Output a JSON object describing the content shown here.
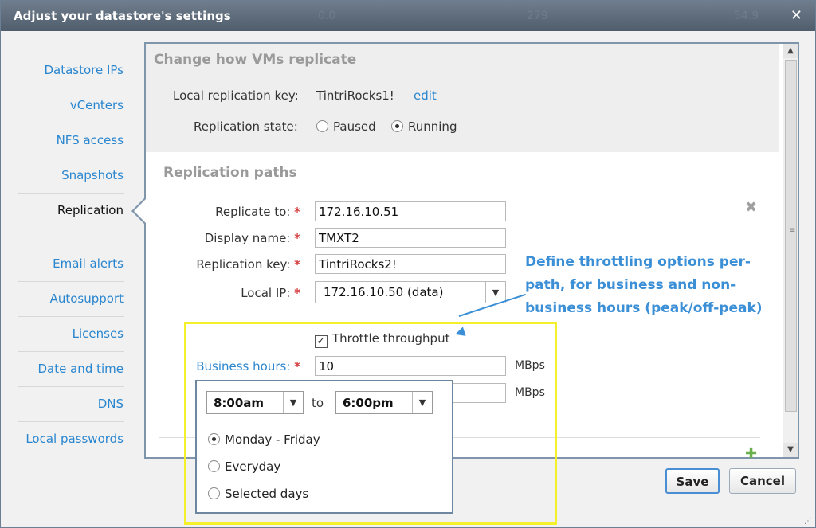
{
  "dialog": {
    "title": "Adjust your datastore's settings",
    "close_label": "✕",
    "ghost_values": [
      "0.0",
      "279",
      "54.9"
    ]
  },
  "nav": {
    "items": [
      {
        "label": "Datastore IPs"
      },
      {
        "label": "vCenters"
      },
      {
        "label": "NFS access"
      },
      {
        "label": "Snapshots"
      },
      {
        "label": "Replication",
        "active": true
      },
      {
        "label": "Email alerts"
      },
      {
        "label": "Autosupport"
      },
      {
        "label": "Licenses"
      },
      {
        "label": "Date and time"
      },
      {
        "label": "DNS"
      },
      {
        "label": "Local passwords"
      }
    ]
  },
  "replicate": {
    "section_title": "Change how VMs replicate",
    "local_key_label": "Local replication key:",
    "local_key_value": "TintriRocks1!",
    "edit_label": "edit",
    "state_label": "Replication state:",
    "state_options": [
      "Paused",
      "Running"
    ],
    "state_selected": "Running"
  },
  "paths": {
    "section_title": "Replication paths",
    "replicate_to_label": "Replicate to:",
    "replicate_to_value": "172.16.10.51",
    "display_name_label": "Display name:",
    "display_name_value": "TMXT2",
    "replication_key_label": "Replication key:",
    "replication_key_value": "TintriRocks2!",
    "local_ip_label": "Local IP:",
    "local_ip_value": "172.16.10.50 (data)",
    "required_mark": "*",
    "throttle_label": "Throttle throughput",
    "throttle_checked": true,
    "business_hours_label": "Business hours:",
    "business_hours_value": "10",
    "unit": "MBps",
    "offpeak_value": ""
  },
  "popup": {
    "from_time": "8:00am",
    "to_label": "to",
    "to_time": "6:00pm",
    "options": [
      "Monday - Friday",
      "Everyday",
      "Selected days"
    ],
    "selected": "Monday - Friday"
  },
  "annotation": {
    "text": "Define throttling options per-path, for business and non-business hours (peak/off-peak)"
  },
  "footer": {
    "save_label": "Save",
    "cancel_label": "Cancel"
  },
  "colors": {
    "accent": "#2a86cf",
    "highlight": "#f4f02a",
    "annotation": "#3b8fd6"
  }
}
